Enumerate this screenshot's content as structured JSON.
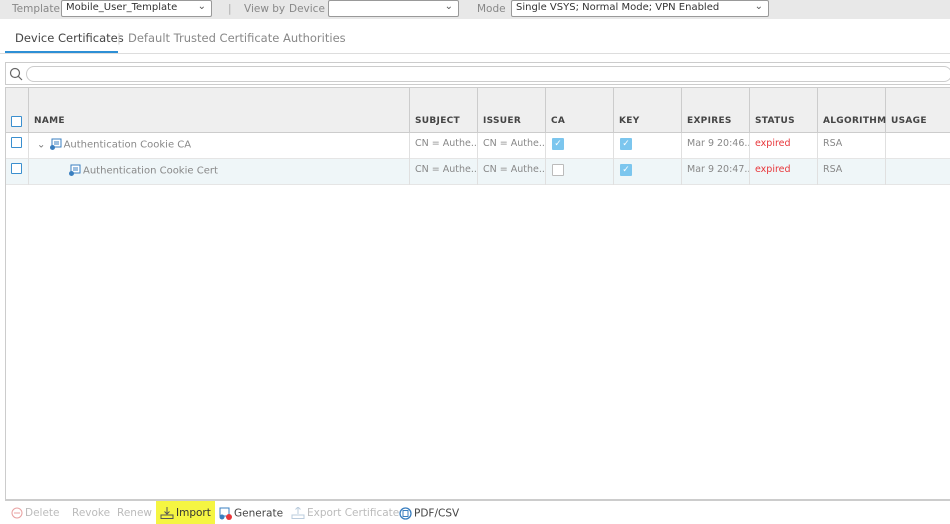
{
  "topbar": {
    "template_label": "Template",
    "template_value": "Mobile_User_Template",
    "viewby_label": "View by",
    "device_label": "Device",
    "device_value": "",
    "mode_label": "Mode",
    "mode_value": "Single VSYS; Normal Mode; VPN Enabled"
  },
  "tabs": [
    {
      "label": "Device Certificates",
      "active": true
    },
    {
      "label": "Default Trusted Certificate Authorities",
      "active": false
    }
  ],
  "search": {
    "placeholder": "",
    "value": ""
  },
  "columns": [
    "NAME",
    "SUBJECT",
    "ISSUER",
    "CA",
    "KEY",
    "EXPIRES",
    "STATUS",
    "ALGORITHM",
    "USAGE"
  ],
  "rows": [
    {
      "name": "Authentication Cookie CA",
      "subject": "CN = Authe...",
      "issuer": "CN = Authe...",
      "ca": true,
      "key": true,
      "expires": "Mar 9 20:46...",
      "status": "expired",
      "algorithm": "RSA",
      "usage": "",
      "expanded": true,
      "level": 0
    },
    {
      "name": "Authentication Cookie Cert",
      "subject": "CN = Authe...",
      "issuer": "CN = Authe...",
      "ca": false,
      "key": true,
      "expires": "Mar 9 20:47...",
      "status": "expired",
      "algorithm": "RSA",
      "usage": "",
      "level": 1
    }
  ],
  "toolbar": {
    "delete": "Delete",
    "revoke": "Revoke",
    "renew": "Renew",
    "import": "Import",
    "generate": "Generate",
    "export": "Export Certificate",
    "pdfcsv": "PDF/CSV"
  },
  "colors": {
    "accent": "#2d8fd5",
    "expired": "#e8373b",
    "highlight": "#f5f542",
    "checked": "#7cc6ee"
  }
}
